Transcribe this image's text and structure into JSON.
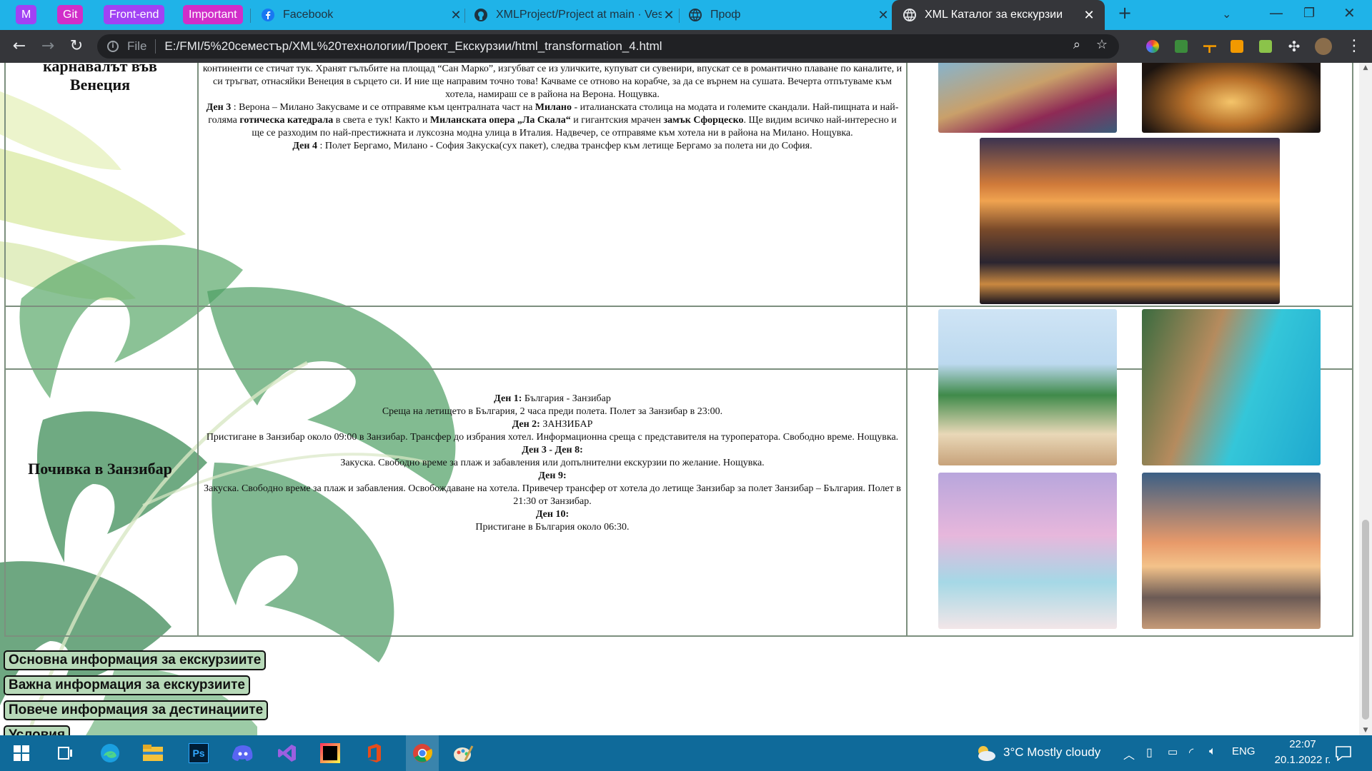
{
  "browser": {
    "bookmarks": [
      {
        "label": "M",
        "color": "#a142f4"
      },
      {
        "label": "Git",
        "color": "#d12ec9"
      },
      {
        "label": "Front-end",
        "color": "#a142f4"
      },
      {
        "label": "Important",
        "color": "#d12ec9"
      }
    ],
    "tabs": [
      {
        "title": "Facebook",
        "icon": "facebook-icon"
      },
      {
        "title": "XMLProject/Project at main · Vesi",
        "icon": "github-icon"
      },
      {
        "title": "Проф",
        "icon": "globe-icon"
      },
      {
        "title": "XML Каталог за екскурзии",
        "icon": "globe-icon",
        "active": true
      }
    ],
    "new_tab": "+",
    "address": {
      "scheme": "File",
      "url": "E:/FMI/5%20семестър/XML%20технологии/Проект_Екскурзии/html_transformation_4.html"
    }
  },
  "page": {
    "venice": {
      "title_line1": "карнавалът във",
      "title_line2": "Венеция",
      "p1": "континенти се стичат тук. Хранят гълъбите на площад “Сан Марко”, изгубват се из уличките, купуват си сувенири, впускат се в романтично плаване по каналите, и си тръгват, отнасяйки Венеция в сърцето си. И ние ще направим точно това! Качваме се отново на корабче, за да се върнем на сушата. Вечерта отпътуваме към хотела, намираш се в района на Верона. Нощувка.",
      "d3_label": "Ден 3",
      "d3_a": " : Верона – Милано Закусваме и се отправяме към централната част на ",
      "d3_b": "Милано",
      "d3_c": " - италианската столица на модата и големите скандали. Най-пищната и най-голяма ",
      "d3_d": "готическа катедрала",
      "d3_e": " в света е тук! Както и ",
      "d3_f": "Миланската опера „Ла Скала“",
      "d3_g": " и гигантския мрачен ",
      "d3_h": "замък Сфорцеско",
      "d3_i": ". Ще видим всичко най-интересно и ще се разходим по най-престижната и луксозна модна улица в Италия. Надвечер, се отправяме към хотела ни в района на Милано. Нощувка.",
      "d4_label": "Ден 4",
      "d4_text": " : Полет Бергамо, Милано - София Закуска(сух пакет), следва трансфер към летище Бергамо за полета ни до София."
    },
    "zanzibar": {
      "title": "Почивка в Занзибар",
      "lines": [
        {
          "b": "Ден 1:",
          "t": " България - Занзибар"
        },
        {
          "b": "",
          "t": "Среща на летището в България, 2 часа преди полета. Полет за Занзибар в 23:00."
        },
        {
          "b": "Ден 2:",
          "t": " ЗАНЗИБАР"
        },
        {
          "b": "",
          "t": "Пристигане в Занзибар около 09:00 в Занзибар. Трансфер до избрания хотел. Информационна среща с представителя на туроператора. Свободно време. Нощувка."
        },
        {
          "b": "Ден 3 - Ден 8:",
          "t": ""
        },
        {
          "b": "",
          "t": "Закуска. Свободно време за плаж и забавления или допълнителни екскурзии по желание. Нощувка."
        },
        {
          "b": "Ден 9:",
          "t": ""
        },
        {
          "b": "",
          "t": "Закуска. Свободно време за плаж и забавления. Освобождаване на хотела. Привечер трансфер от хотела до летище Занзибар за полет Занзибар – България. Полет в 21:30 от Занзибар."
        },
        {
          "b": "Ден 10:",
          "t": ""
        },
        {
          "b": "",
          "t": "Пристигане в България около 06:30."
        }
      ]
    },
    "links": [
      "Основна информация за екскурзиите",
      "Важна информация за екскурзиите",
      "Повече информация за дестинациите",
      "Условия"
    ]
  },
  "taskbar": {
    "apps": [
      "windows-start-icon",
      "task-view-icon",
      "edge-icon",
      "file-explorer-icon",
      "photoshop-icon",
      "discord-icon",
      "visual-studio-icon",
      "jetbrains-icon",
      "office-icon",
      "chrome-icon",
      "paint-icon"
    ],
    "photoshop_label": "Ps",
    "weather": "3°C  Mostly cloudy",
    "lang": "ENG",
    "time": "22:07",
    "date": "20.1.2022 г."
  }
}
